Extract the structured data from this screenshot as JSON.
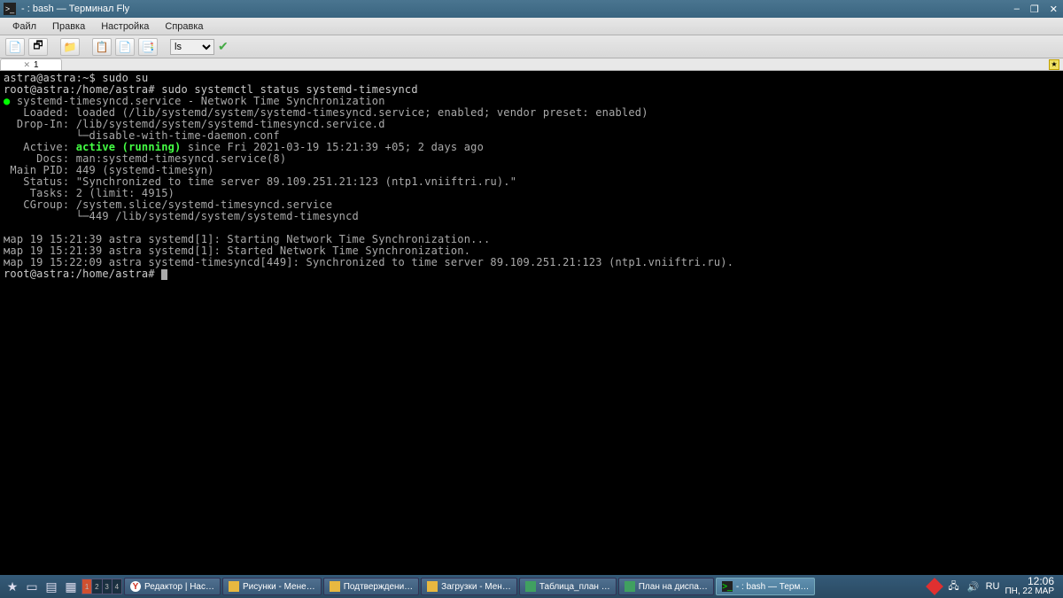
{
  "titlebar": {
    "title": "- : bash — Терминал Fly"
  },
  "menu": {
    "file": "Файл",
    "edit": "Правка",
    "settings": "Настройка",
    "help": "Справка"
  },
  "toolbar": {
    "select": "ls"
  },
  "tab": {
    "label": "1"
  },
  "terminal": {
    "line1_prompt": "astra@astra:~$",
    "line1_cmd": "sudo su",
    "line2_prompt": "root@astra:/home/astra#",
    "line2_cmd": "sudo systemctl status systemd-timesyncd",
    "svc_dot": "●",
    "svc_name": "systemd-timesyncd.service - Network Time Synchronization",
    "loaded_lbl": "   Loaded:",
    "loaded_val": "loaded (/lib/systemd/system/systemd-timesyncd.service; enabled; vendor preset: enabled)",
    "dropin_lbl": "  Drop-In:",
    "dropin_val": "/lib/systemd/system/systemd-timesyncd.service.d",
    "dropin_sub": "           └─disable-with-time-daemon.conf",
    "active_lbl": "   Active:",
    "active_val": "active (running)",
    "active_since": "since Fri 2021-03-19 15:21:39 +05; 2 days ago",
    "docs_lbl": "     Docs:",
    "docs_val": "man:systemd-timesyncd.service(8)",
    "pid_lbl": " Main PID:",
    "pid_val": "449 (systemd-timesyn)",
    "status_lbl": "   Status:",
    "status_val": "\"Synchronized to time server 89.109.251.21:123 (ntp1.vniiftri.ru).\"",
    "tasks_lbl": "    Tasks:",
    "tasks_val": "2 (limit: 4915)",
    "cgroup_lbl": "   CGroup:",
    "cgroup_val": "/system.slice/systemd-timesyncd.service",
    "cgroup_sub": "           └─449 /lib/systemd/system/systemd-timesyncd",
    "log1": "мар 19 15:21:39 astra systemd[1]: Starting Network Time Synchronization...",
    "log2": "мар 19 15:21:39 astra systemd[1]: Started Network Time Synchronization.",
    "log3": "мар 19 15:22:09 astra systemd-timesyncd[449]: Synchronized to time server 89.109.251.21:123 (ntp1.vniiftri.ru).",
    "final_prompt": "root@astra:/home/astra#"
  },
  "taskbar": {
    "items": [
      {
        "label": "Редактор | Нас…"
      },
      {
        "label": "Рисунки - Мене…"
      },
      {
        "label": "Подтверждени…"
      },
      {
        "label": "Загрузки - Мен…"
      },
      {
        "label": "Таблица_план …"
      },
      {
        "label": "План на диспа…"
      },
      {
        "label": "- : bash — Терм…"
      }
    ],
    "ws": [
      "1",
      "2",
      "3",
      "4"
    ],
    "lang": "RU",
    "time": "12:06",
    "date": "ПН, 22 МАР"
  }
}
